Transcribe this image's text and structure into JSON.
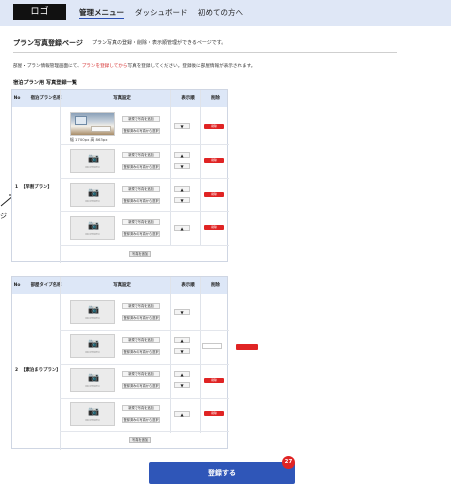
{
  "header": {
    "logo": "ロゴ",
    "nav": [
      "管理メニュー",
      "ダッシュボード",
      "初めての方へ"
    ]
  },
  "page": {
    "title": "プラン写真登録ページ",
    "subtitle": "プラン写真の登録・削除・表示順管理ができるページです。",
    "notice_before": "部屋・プラン情報管理画面にて、",
    "notice_red": "プランを登録してから",
    "notice_after": "写真を登録してください。登録後に部屋情報が表示されます。",
    "left_mark": "ジ"
  },
  "section1": {
    "label": "宿泊プラン用 写真登録一覧",
    "headers": [
      "No",
      "宿泊プラン名称",
      "写真設定",
      "表示順",
      "削除"
    ],
    "row_no": "1",
    "row_name": "【早割プラン】",
    "photo_size": "幅 1700px 高 863px",
    "add_button": "写真を追加"
  },
  "section2": {
    "headers": [
      "No",
      "部屋タイプ名称",
      "写真設定",
      "表示順",
      "削除"
    ],
    "row_no": "2",
    "row_name": "【素泊まりプラン】",
    "add_button": "写真を追加"
  },
  "photo": {
    "upload_new": "新規で写真を追加",
    "choose_registered": "登録済みの写真から選択",
    "delete": "削除",
    "placeholder": "NO PHOTO"
  },
  "order": {
    "up": "▲",
    "down": "▼"
  },
  "submit": {
    "label": "登録する",
    "badge": "27"
  }
}
